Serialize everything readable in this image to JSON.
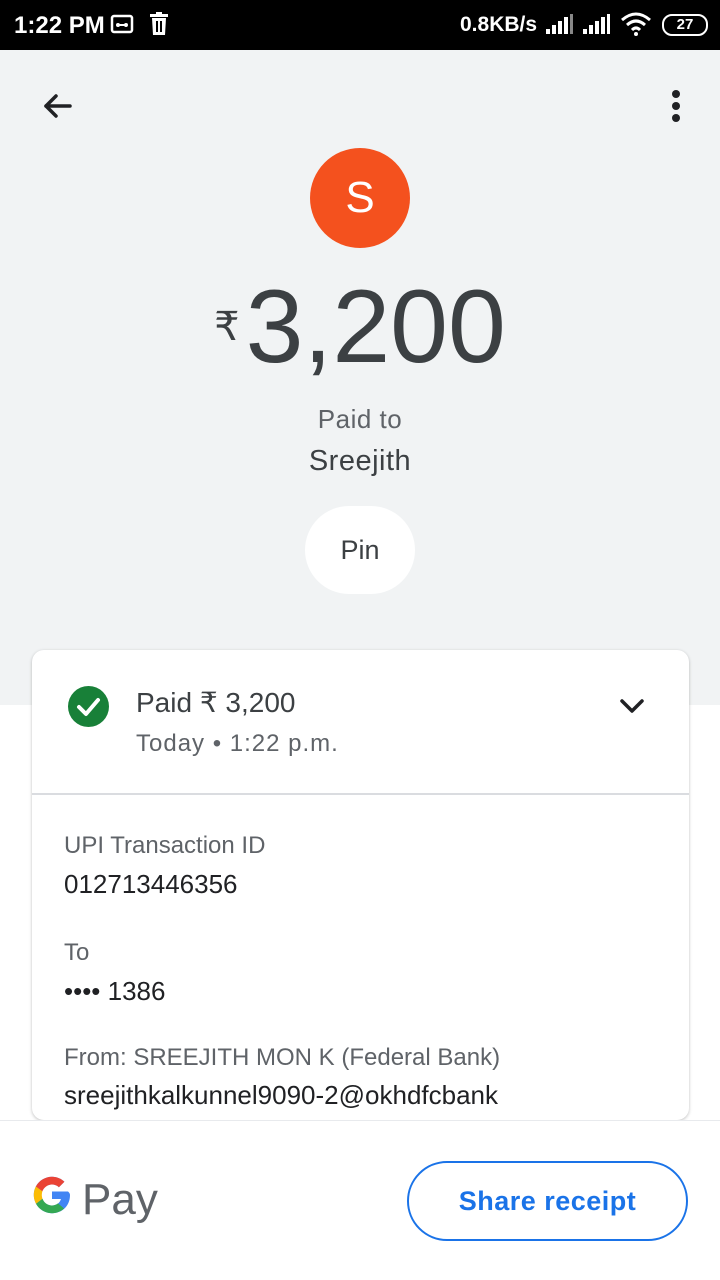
{
  "status_bar": {
    "time": "1:22 PM",
    "network_speed": "0.8KB/s",
    "battery": "27",
    "icons": [
      "voicemail-icon",
      "trash-icon",
      "signal-icon",
      "signal-icon",
      "wifi-icon",
      "battery-icon"
    ]
  },
  "header": {
    "back_icon": "arrow-back-icon",
    "more_icon": "more-vertical-icon"
  },
  "payment": {
    "avatar_letter": "S",
    "avatar_color": "#f4511e",
    "currency_symbol": "₹",
    "amount": "3,200",
    "paid_to_label": "Paid to",
    "payee_name": "Sreejith",
    "pin_label": "Pin"
  },
  "details": {
    "status_icon": "check-circle-icon",
    "status_color": "#188038",
    "status_text": "Paid ₹ 3,200",
    "timestamp": "Today • 1:22 p.m.",
    "expand_icon": "chevron-down-icon",
    "fields": [
      {
        "label": "UPI Transaction ID",
        "value": "012713446356"
      },
      {
        "label": "To",
        "value": "•••• 1386"
      },
      {
        "label": "From: SREEJITH MON K (Federal Bank)",
        "value": "sreejithkalkunnel9090-2@okhdfcbank"
      }
    ]
  },
  "footer": {
    "logo_text": "Pay",
    "share_label": "Share receipt",
    "accent_color": "#1a73e8"
  }
}
